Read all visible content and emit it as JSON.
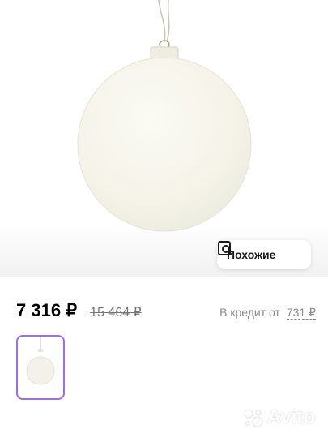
{
  "similar_button": {
    "label": "Похожие",
    "icon": "search-similar-icon"
  },
  "price": {
    "current": "7 316 ₽",
    "old": "15 464 ₽",
    "credit_label": "В кредит от",
    "credit_value": "731 ₽"
  },
  "gallery": {
    "selected_index": 0,
    "accent": "#a169f7"
  },
  "watermark": {
    "text": "Avito"
  }
}
